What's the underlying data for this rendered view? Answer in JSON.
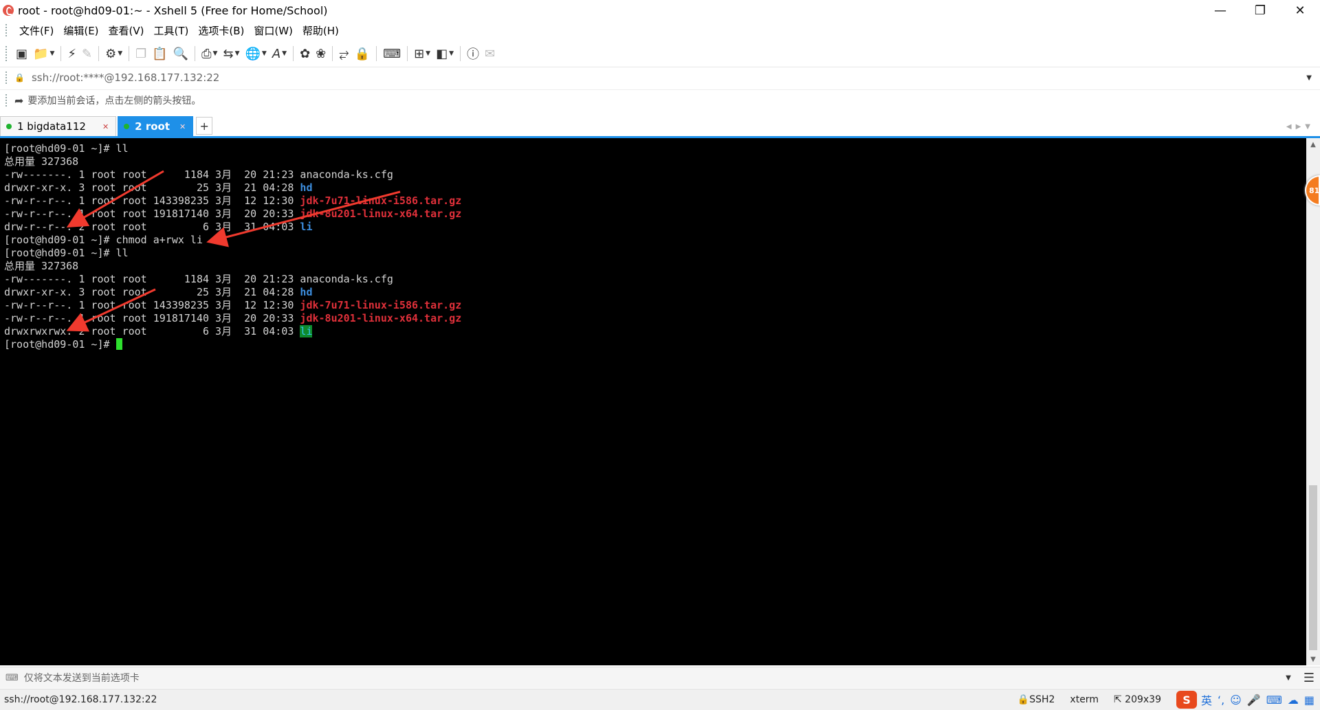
{
  "window": {
    "title": "root - root@hd09-01:~ - Xshell 5 (Free for Home/School)",
    "minimize": "—",
    "maximize": "❐",
    "close": "✕"
  },
  "menu": [
    "文件(F)",
    "编辑(E)",
    "查看(V)",
    "工具(T)",
    "选项卡(B)",
    "窗口(W)",
    "帮助(H)"
  ],
  "toolbar": {
    "icons": [
      "new-session-icon",
      "open-folder-icon",
      "reconnect-icon",
      "disconnect-icon",
      "properties-icon",
      "copy-icon",
      "paste-icon",
      "find-icon",
      "print-icon",
      "transfer-icon",
      "globe-icon",
      "font-icon",
      "xftp-icon",
      "xmanager-icon",
      "fullscreen-icon",
      "lock-icon",
      "keyboard-icon",
      "new-tab-icon",
      "layout-icon",
      "help-icon",
      "chat-icon"
    ]
  },
  "address": {
    "value": "ssh://root:****@192.168.177.132:22"
  },
  "hint": {
    "text": "要添加当前会话，点击左侧的箭头按钮。"
  },
  "tabs": [
    {
      "label": "1 bigdata112",
      "active": false
    },
    {
      "label": "2 root",
      "active": true
    }
  ],
  "terminal": {
    "lines": [
      [
        {
          "t": "[root@hd09-01 ~]# ll"
        }
      ],
      [
        {
          "t": "总用量 327368"
        }
      ],
      [
        {
          "t": "-rw-------. 1 root root      1184 3月  20 21:23 "
        },
        {
          "t": "anaconda-ks.cfg"
        }
      ],
      [
        {
          "t": "drwxr-xr-x. 3 root root        25 3月  21 04:28 "
        },
        {
          "t": "hd",
          "c": "c-blue"
        }
      ],
      [
        {
          "t": "-rw-r--r--. 1 root root 143398235 3月  12 12:30 "
        },
        {
          "t": "jdk-7u71-linux-i586.tar.gz",
          "c": "c-red"
        }
      ],
      [
        {
          "t": "-rw-r--r--. 1 root root 191817140 3月  20 20:33 "
        },
        {
          "t": "jdk-8u201-linux-x64.tar.gz",
          "c": "c-red"
        }
      ],
      [
        {
          "t": "drw-r--r--. 2 root root         6 3月  31 04:03 "
        },
        {
          "t": "li",
          "c": "c-blue"
        }
      ],
      [
        {
          "t": "[root@hd09-01 ~]# chmod a+rwx li"
        }
      ],
      [
        {
          "t": "[root@hd09-01 ~]# ll"
        }
      ],
      [
        {
          "t": "总用量 327368"
        }
      ],
      [
        {
          "t": "-rw-------. 1 root root      1184 3月  20 21:23 "
        },
        {
          "t": "anaconda-ks.cfg"
        }
      ],
      [
        {
          "t": "drwxr-xr-x. 3 root root        25 3月  21 04:28 "
        },
        {
          "t": "hd",
          "c": "c-blue"
        }
      ],
      [
        {
          "t": "-rw-r--r--. 1 root root 143398235 3月  12 12:30 "
        },
        {
          "t": "jdk-7u71-linux-i586.tar.gz",
          "c": "c-red"
        }
      ],
      [
        {
          "t": "-rw-r--r--. 1 root root 191817140 3月  20 20:33 "
        },
        {
          "t": "jdk-8u201-linux-x64.tar.gz",
          "c": "c-red"
        }
      ],
      [
        {
          "t": "drwxrwxrwx. 2 root root         6 3月  31 04:03 "
        },
        {
          "t": "li",
          "c": "c-hl"
        }
      ],
      [
        {
          "t": "[root@hd09-01 ~]# "
        },
        {
          "cursor": true
        }
      ]
    ]
  },
  "badge": {
    "text": "81"
  },
  "sendbar": {
    "placeholder": "仅将文本发送到当前选项卡"
  },
  "status": {
    "connection": "ssh://root@192.168.177.132:22",
    "protocol": "SSH2",
    "terminal_type": "xterm",
    "size": "209x39",
    "ime_lang": "英",
    "sogou": "S"
  },
  "colors": {
    "accent": "#1e90e8",
    "cursor": "#2ee02e",
    "dir": "#3d8fe0",
    "archive": "#e0303a",
    "arrow": "#f03a2e"
  }
}
